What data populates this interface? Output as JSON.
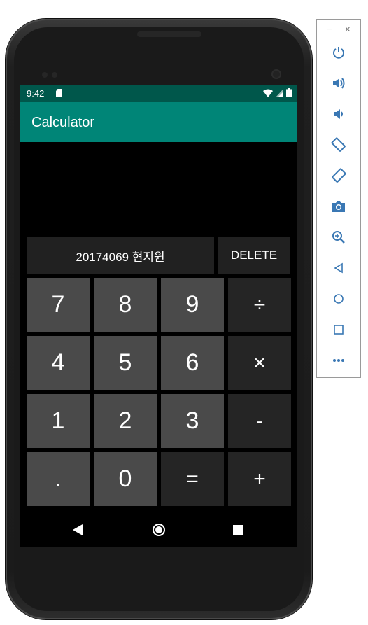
{
  "status_bar": {
    "time": "9:42"
  },
  "app_bar": {
    "title": "Calculator"
  },
  "display": {
    "text": "20174069 현지원"
  },
  "delete_label": "DELETE",
  "keys": [
    {
      "label": "7",
      "kind": "num"
    },
    {
      "label": "8",
      "kind": "num"
    },
    {
      "label": "9",
      "kind": "num"
    },
    {
      "label": "÷",
      "kind": "op"
    },
    {
      "label": "4",
      "kind": "num"
    },
    {
      "label": "5",
      "kind": "num"
    },
    {
      "label": "6",
      "kind": "num"
    },
    {
      "label": "×",
      "kind": "op"
    },
    {
      "label": "1",
      "kind": "num"
    },
    {
      "label": "2",
      "kind": "num"
    },
    {
      "label": "3",
      "kind": "num"
    },
    {
      "label": "-",
      "kind": "op"
    },
    {
      "label": ".",
      "kind": "num"
    },
    {
      "label": "0",
      "kind": "num"
    },
    {
      "label": "=",
      "kind": "op"
    },
    {
      "label": "+",
      "kind": "op"
    }
  ],
  "colors": {
    "status_bar": "#00574b",
    "app_bar": "#008577",
    "num_key": "#4a4a4a",
    "op_key": "#252525"
  },
  "toolbar": {
    "window_controls": {
      "minimize": "−",
      "close": "×"
    },
    "icons": [
      "power-icon",
      "volume-up-icon",
      "volume-down-icon",
      "rotate-left-icon",
      "rotate-right-icon",
      "camera-icon",
      "zoom-icon",
      "back-icon",
      "home-icon",
      "overview-icon",
      "more-icon"
    ]
  }
}
